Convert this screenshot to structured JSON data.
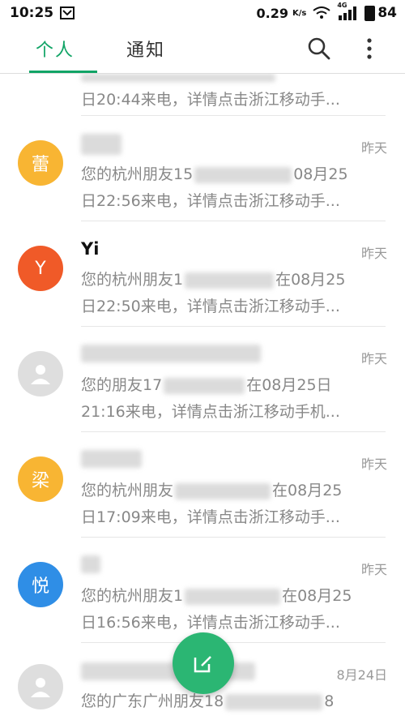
{
  "status_bar": {
    "time": "10:25",
    "speed": "0.29",
    "speed_unit": "K/s",
    "network": "4G",
    "battery": "84"
  },
  "app_bar": {
    "tabs": [
      {
        "label": "个人",
        "active": true
      },
      {
        "label": "通知",
        "active": false
      }
    ],
    "icons": [
      "search-icon",
      "more-vertical-icon"
    ],
    "accent_color": "#11a466"
  },
  "items": [
    {
      "name": "",
      "date": "",
      "line1": "",
      "line2": "日20:44来电，详情点击浙江移动手...",
      "avatar": null
    },
    {
      "name": "",
      "date": "昨天",
      "line1": "您的杭州朋友15",
      "line1_tail": "08月25",
      "line2": "日22:56来电，详情点击浙江移动手...",
      "avatar": {
        "text": "蕾",
        "color": "#f8b533"
      }
    },
    {
      "name": "Yi",
      "date": "昨天",
      "line1": "您的杭州朋友1",
      "line1_tail": "在08月25",
      "line2": "日22:50来电，详情点击浙江移动手...",
      "avatar": {
        "text": "Y",
        "color": "#f05a28"
      }
    },
    {
      "name": "",
      "date": "昨天",
      "line1": "您的朋友17",
      "line1_tail": "在08月25日",
      "line2": "21:16来电，详情点击浙江移动手机...",
      "avatar": {
        "text": "",
        "color": "#dedede",
        "icon": "person-icon"
      }
    },
    {
      "name": "",
      "date": "昨天",
      "line1": "您的杭州朋友",
      "line1_tail": "在08月25",
      "line2": "日17:09来电，详情点击浙江移动手...",
      "avatar": {
        "text": "梁",
        "color": "#f8b533"
      }
    },
    {
      "name": "",
      "date": "昨天",
      "line1": "您的杭州朋友1",
      "line1_tail": "在08月25",
      "line2": "日16:56来电，详情点击浙江移动手...",
      "avatar": {
        "text": "悦",
        "color": "#2f8ee6"
      }
    },
    {
      "name": "",
      "date": "8月24日",
      "line1": "您的广东广州朋友18",
      "line1_tail": "8",
      "line2": "",
      "avatar": {
        "text": "",
        "color": "#dedede",
        "icon": "person-icon"
      }
    }
  ],
  "fab": {
    "icon": "compose-icon",
    "color": "#2bb673"
  }
}
